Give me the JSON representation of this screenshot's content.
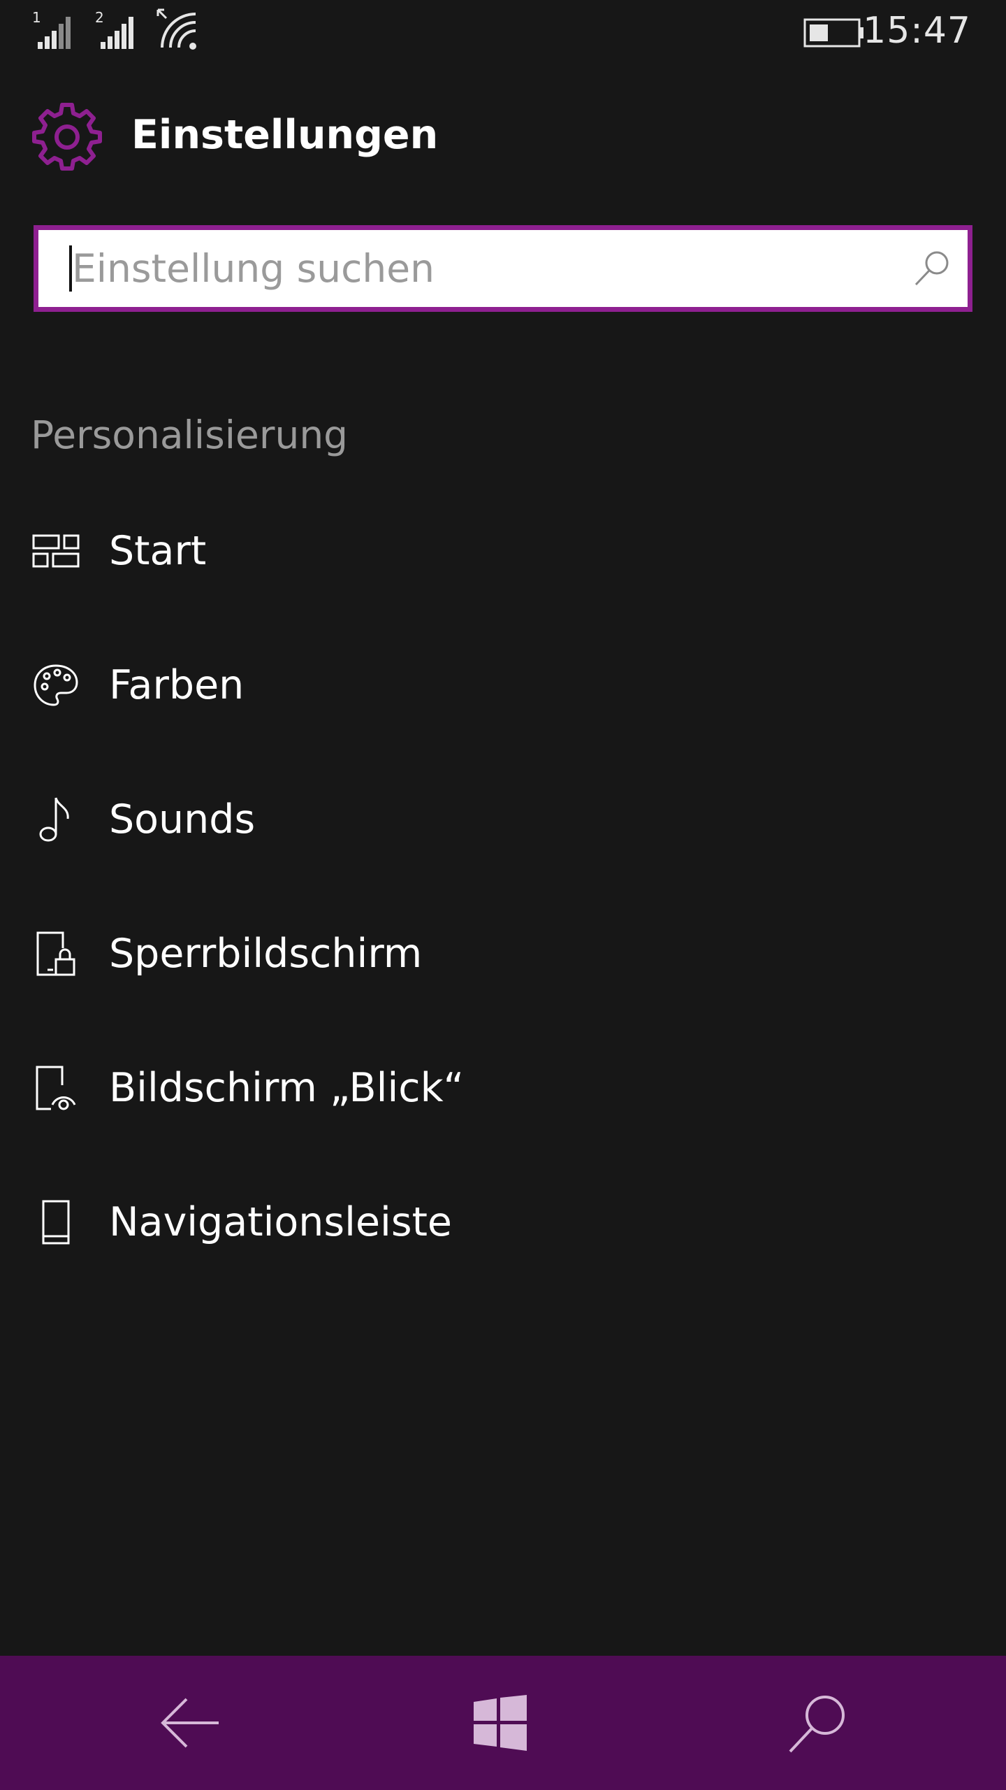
{
  "status_bar": {
    "sim1_label": "1",
    "sim2_label": "2",
    "icons": [
      "signal-sim1-icon",
      "signal-sim2-icon",
      "wifi-icon",
      "battery-icon"
    ],
    "time": "15:47"
  },
  "header": {
    "icon": "gear-icon",
    "title": "Einstellungen"
  },
  "search": {
    "placeholder": "Einstellung suchen",
    "value": "",
    "icon": "search-icon"
  },
  "section": {
    "title": "Personalisierung",
    "items": [
      {
        "label": "Start",
        "icon": "start-tiles-icon"
      },
      {
        "label": "Farben",
        "icon": "palette-icon"
      },
      {
        "label": "Sounds",
        "icon": "music-note-icon"
      },
      {
        "label": "Sperrbildschirm",
        "icon": "lock-screen-icon"
      },
      {
        "label": "Bildschirm „Blick“",
        "icon": "glance-screen-icon"
      },
      {
        "label": "Navigationsleiste",
        "icon": "phone-icon"
      }
    ]
  },
  "nav_bar": {
    "buttons": [
      "back-arrow-icon",
      "windows-logo-icon",
      "search-icon"
    ]
  },
  "colors": {
    "background": "#171717",
    "accent": "#8e2090",
    "nav_bar": "#4f0c54",
    "secondary_text": "#9a9a9a"
  }
}
